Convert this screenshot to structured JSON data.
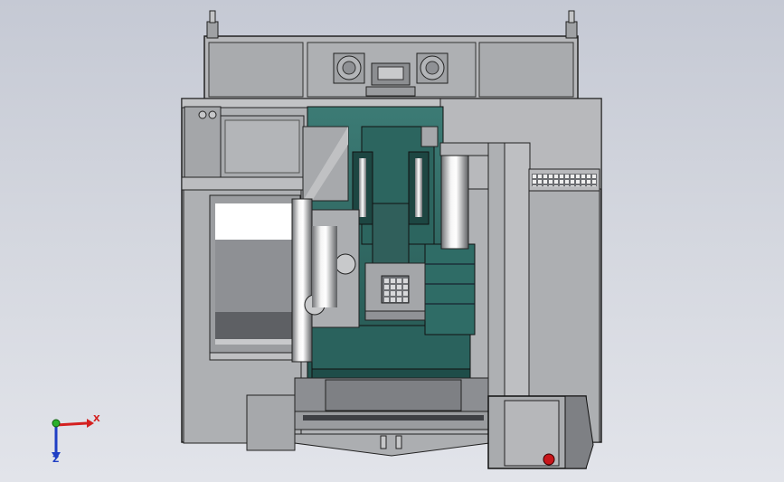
{
  "viewport": {
    "background_top": "#c5c9d4",
    "background_bottom": "#e2e4ea"
  },
  "model": {
    "view": "front",
    "body_color": "#b2b3b6",
    "panel_color": "#a6a8ac",
    "window_color": "#8d8f93",
    "table_color": "#2e6b66",
    "table_dark": "#1f4d49",
    "stop_button_color": "#c8161b"
  },
  "triad": {
    "x_label": "X",
    "z_label": "Z",
    "x_color": "#d42020",
    "y_color": "#2bb02b",
    "z_color": "#1f3fc4"
  }
}
